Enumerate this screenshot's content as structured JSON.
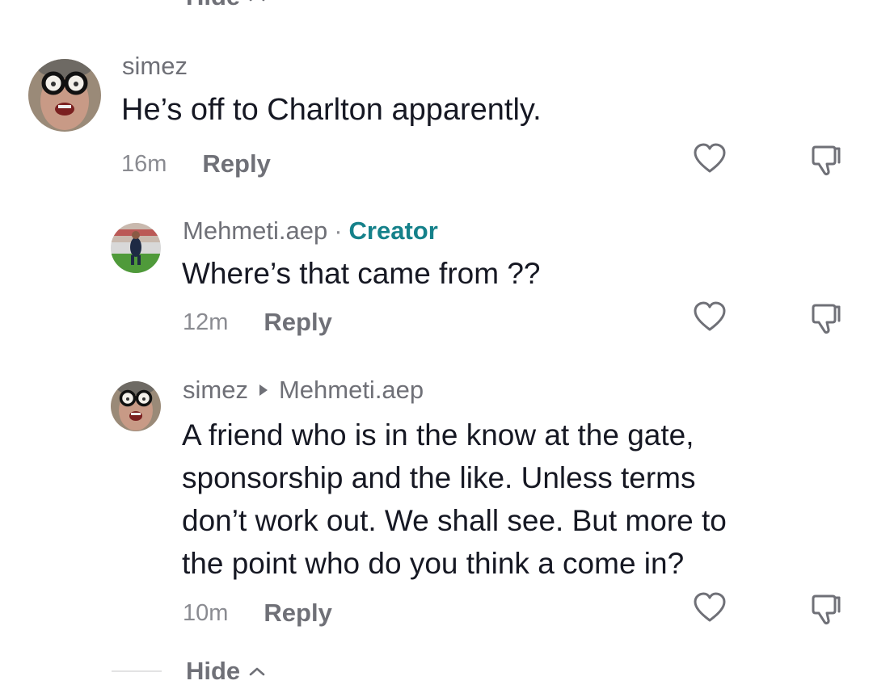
{
  "top_toggle": {
    "label": "Hide"
  },
  "comments": [
    {
      "username": "simez",
      "text": "He’s off to Charlton apparently.",
      "time": "16m",
      "reply_label": "Reply"
    },
    {
      "username": "Mehmeti.aep",
      "badge_separator": "·",
      "badge": "Creator",
      "text": "Where’s that came from ??",
      "time": "12m",
      "reply_label": "Reply"
    },
    {
      "username": "simez",
      "reply_to": "Mehmeti.aep",
      "text_lines": [
        "A friend who is in the know at the gate,",
        "sponsorship and the like. Unless terms",
        "don’t work out. We shall see. But more to",
        "the point who do you think a come in?"
      ],
      "time": "10m",
      "reply_label": "Reply"
    }
  ],
  "bottom_toggle": {
    "label": "Hide"
  },
  "icons": {
    "like": "heart-outline-icon",
    "dislike": "thumbs-down-outline-icon",
    "expand": "chevron-up-icon",
    "reply_to": "triangle-right-icon"
  },
  "colors": {
    "creator_badge": "#15818a",
    "secondary_text": "#6f7077",
    "primary_text": "#161823"
  }
}
